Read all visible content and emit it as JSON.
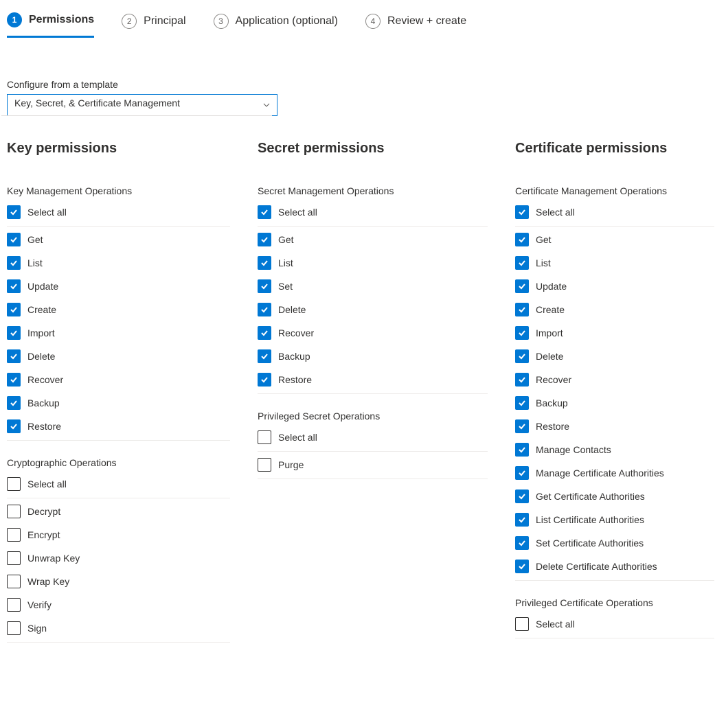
{
  "tabs": [
    {
      "num": "1",
      "label": "Permissions",
      "active": true
    },
    {
      "num": "2",
      "label": "Principal",
      "active": false
    },
    {
      "num": "3",
      "label": "Application (optional)",
      "active": false
    },
    {
      "num": "4",
      "label": "Review + create",
      "active": false
    }
  ],
  "template": {
    "label": "Configure from a template",
    "selected": "Key, Secret, & Certificate Management"
  },
  "columns": [
    {
      "title": "Key permissions",
      "class": "col-key",
      "groups": [
        {
          "title": "Key Management Operations",
          "select_all": {
            "label": "Select all",
            "checked": true
          },
          "items": [
            {
              "label": "Get",
              "checked": true
            },
            {
              "label": "List",
              "checked": true
            },
            {
              "label": "Update",
              "checked": true
            },
            {
              "label": "Create",
              "checked": true
            },
            {
              "label": "Import",
              "checked": true
            },
            {
              "label": "Delete",
              "checked": true
            },
            {
              "label": "Recover",
              "checked": true
            },
            {
              "label": "Backup",
              "checked": true
            },
            {
              "label": "Restore",
              "checked": true
            }
          ]
        },
        {
          "title": "Cryptographic Operations",
          "select_all": {
            "label": "Select all",
            "checked": false
          },
          "items": [
            {
              "label": "Decrypt",
              "checked": false
            },
            {
              "label": "Encrypt",
              "checked": false
            },
            {
              "label": "Unwrap Key",
              "checked": false
            },
            {
              "label": "Wrap Key",
              "checked": false
            },
            {
              "label": "Verify",
              "checked": false
            },
            {
              "label": "Sign",
              "checked": false
            }
          ]
        }
      ]
    },
    {
      "title": "Secret permissions",
      "class": "col-secret",
      "groups": [
        {
          "title": "Secret Management Operations",
          "select_all": {
            "label": "Select all",
            "checked": true
          },
          "items": [
            {
              "label": "Get",
              "checked": true
            },
            {
              "label": "List",
              "checked": true
            },
            {
              "label": "Set",
              "checked": true
            },
            {
              "label": "Delete",
              "checked": true
            },
            {
              "label": "Recover",
              "checked": true
            },
            {
              "label": "Backup",
              "checked": true
            },
            {
              "label": "Restore",
              "checked": true
            }
          ]
        },
        {
          "title": "Privileged Secret Operations",
          "select_all": {
            "label": "Select all",
            "checked": false
          },
          "items": [
            {
              "label": "Purge",
              "checked": false
            }
          ]
        }
      ]
    },
    {
      "title": "Certificate permissions",
      "class": "col-cert",
      "groups": [
        {
          "title": "Certificate Management Operations",
          "select_all": {
            "label": "Select all",
            "checked": true
          },
          "items": [
            {
              "label": "Get",
              "checked": true
            },
            {
              "label": "List",
              "checked": true
            },
            {
              "label": "Update",
              "checked": true
            },
            {
              "label": "Create",
              "checked": true
            },
            {
              "label": "Import",
              "checked": true
            },
            {
              "label": "Delete",
              "checked": true
            },
            {
              "label": "Recover",
              "checked": true
            },
            {
              "label": "Backup",
              "checked": true
            },
            {
              "label": "Restore",
              "checked": true
            },
            {
              "label": "Manage Contacts",
              "checked": true
            },
            {
              "label": "Manage Certificate Authorities",
              "checked": true
            },
            {
              "label": "Get Certificate Authorities",
              "checked": true
            },
            {
              "label": "List Certificate Authorities",
              "checked": true
            },
            {
              "label": "Set Certificate Authorities",
              "checked": true
            },
            {
              "label": "Delete Certificate Authorities",
              "checked": true
            }
          ]
        },
        {
          "title": "Privileged Certificate Operations",
          "select_all": {
            "label": "Select all",
            "checked": false
          },
          "items": []
        }
      ]
    }
  ]
}
